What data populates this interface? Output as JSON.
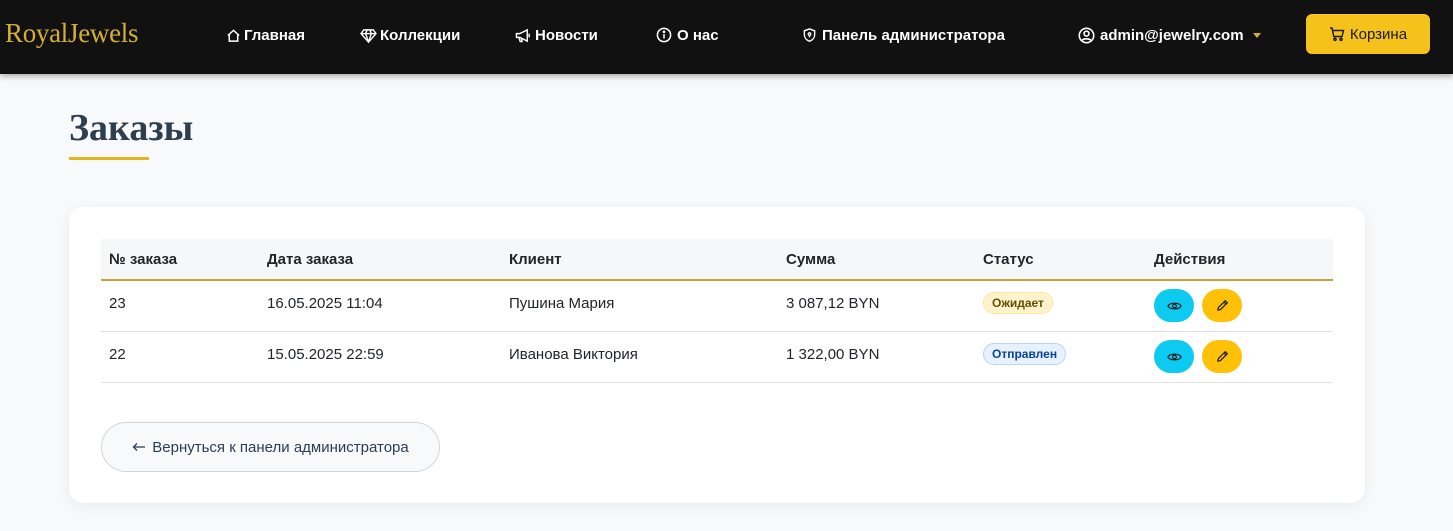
{
  "nav": {
    "brand": "RoyalJewels",
    "home": "Главная",
    "collections": "Коллекции",
    "news": "Новости",
    "about": "О нас",
    "admin_panel": "Панель администратора",
    "user": "admin@jewelry.com",
    "cart": "Корзина"
  },
  "page": {
    "title": "Заказы"
  },
  "table": {
    "headers": [
      "№ заказа",
      "Дата заказа",
      "Клиент",
      "Сумма",
      "Статус",
      "Действия"
    ],
    "rows": [
      {
        "id": "23",
        "date": "16.05.2025 11:04",
        "client": "Пушина Мария",
        "sum": "3 087,12 BYN",
        "status": "Ожидает"
      },
      {
        "id": "22",
        "date": "15.05.2025 22:59",
        "client": "Иванова Виктория",
        "sum": "1 322,00 BYN",
        "status": "Отправлен"
      }
    ]
  },
  "back_button": "Вернуться к панели администратора",
  "colors": {
    "navbar": "#111111",
    "brand_gold": "#d4af37",
    "cart_button": "#f4c21b",
    "view_button": "#0dcaf0",
    "edit_button": "#ffc107",
    "title_color": "#2c3e50"
  },
  "icons": {
    "home": "house-icon",
    "collections": "gem-icon",
    "news": "megaphone-icon",
    "about": "info-circle-icon",
    "admin": "shield-icon",
    "user": "user-circle-icon",
    "cart": "cart-icon",
    "view": "eye-icon",
    "edit": "pencil-icon",
    "back": "arrow-left-icon"
  }
}
